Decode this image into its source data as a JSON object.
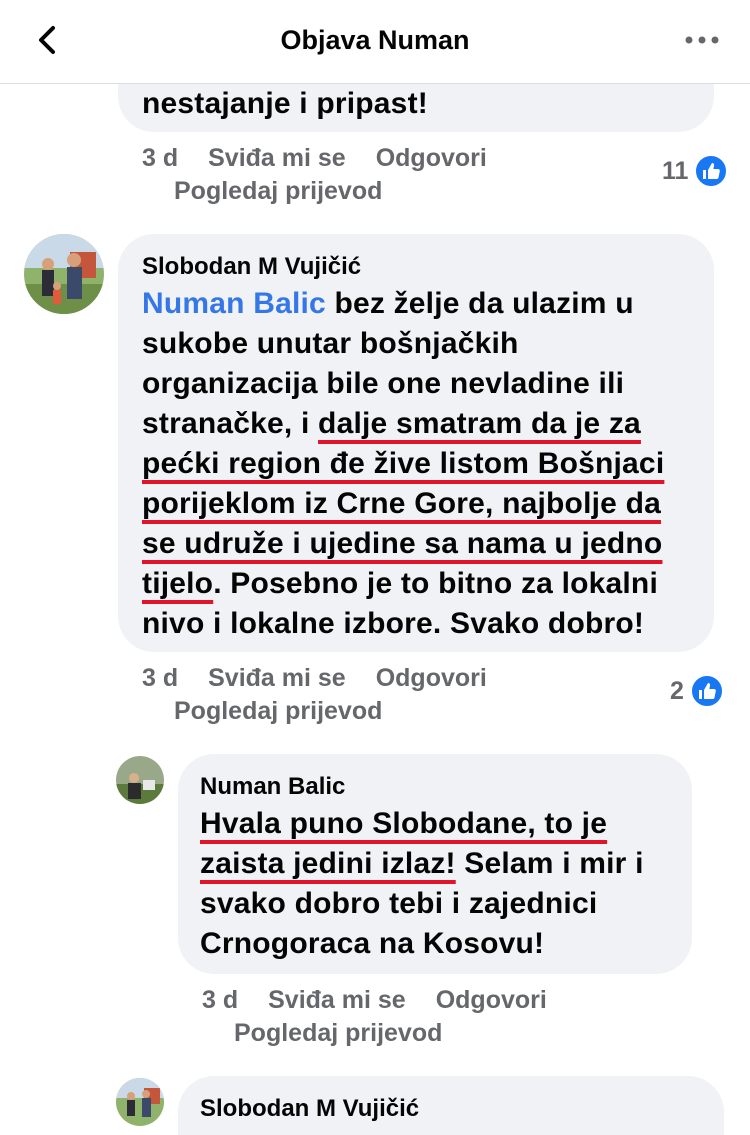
{
  "header": {
    "title": "Objava Numan"
  },
  "comments": [
    {
      "tail_text": "nestajanje i pripast!",
      "time": "3 d",
      "like_label": "Sviđa mi se",
      "reply_label": "Odgovori",
      "translate_label": "Pogledaj prijevod",
      "reaction_count": "11"
    },
    {
      "author": "Slobodan M Vujičić",
      "mention": "Numan Balic",
      "text_parts": [
        " bez želje da ulazim u sukobe unutar bošnjačkih organizacija bile one nevladine ili stranačke, i ",
        "dalje smatram da je za pećki region đe žive listom Bošnjaci porijeklom iz Crne Gore, najbolje da se udruže i ujedine sa nama u jedno tijelo",
        ". Posebno je to bitno za lokalni nivo i lokalne izbore. Svako dobro!"
      ],
      "time": "3 d",
      "like_label": "Sviđa mi se",
      "reply_label": "Odgovori",
      "translate_label": "Pogledaj prijevod",
      "reaction_count": "2"
    },
    {
      "author": "Numan Balic",
      "text_parts": [
        "Hvala puno Slobodane, to je zaista jedini izlaz!",
        " Selam i mir i svako dobro tebi i zajednici Crnogoraca na Kosovu!"
      ],
      "time": "3 d",
      "like_label": "Sviđa mi se",
      "reply_label": "Odgovori",
      "translate_label": "Pogledaj prijevod"
    },
    {
      "author": "Slobodan M Vujičić"
    }
  ],
  "icons": {
    "back": "chevron-left-icon",
    "more": "more-horizontal-icon",
    "like": "thumbs-up-icon"
  },
  "colors": {
    "mention": "#3578e5",
    "like_blue": "#1877f2",
    "underline_red": "#e0152a",
    "bubble_bg": "#f0f2f5",
    "meta_gray": "#65676b"
  }
}
